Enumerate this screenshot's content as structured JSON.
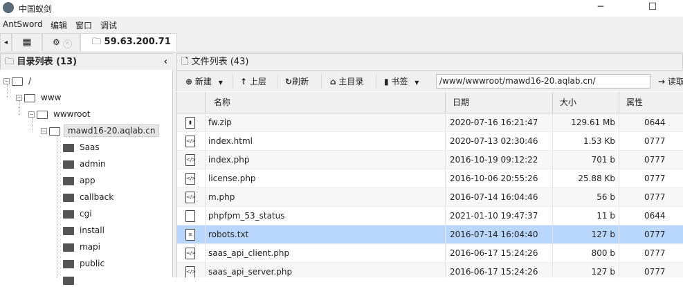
{
  "window": {
    "title": "中国蚁剑",
    "minimize": "─",
    "maximize": "☐",
    "close": "✕"
  },
  "menu": [
    "AntSword",
    "编辑",
    "窗口",
    "调试"
  ],
  "tabs": {
    "scroll_left": "◂",
    "grid_icon": "▦",
    "settings_icon": "⚙",
    "active": "59.63.200.71",
    "close": "×"
  },
  "left_panel": {
    "title": "目录列表 (13)",
    "collapse": "‹",
    "tree": [
      {
        "label": "/",
        "level": 0
      },
      {
        "label": "www",
        "level": 1
      },
      {
        "label": "wwwroot",
        "level": 2
      },
      {
        "label": "mawd16-20.aqlab.cn",
        "level": 3,
        "selected": true
      },
      {
        "label": "Saas",
        "level": 4
      },
      {
        "label": "admin",
        "level": 4
      },
      {
        "label": "app",
        "level": 4
      },
      {
        "label": "callback",
        "level": 4
      },
      {
        "label": "cgi",
        "level": 4
      },
      {
        "label": "install",
        "level": 4
      },
      {
        "label": "mapi",
        "level": 4
      },
      {
        "label": "public",
        "level": 4
      },
      {
        "label": "",
        "level": 4
      }
    ]
  },
  "right_panel": {
    "title": "文件列表 (43)",
    "toolbar": {
      "new": "新建",
      "up": "上层",
      "refresh": "刷新",
      "home": "主目录",
      "bookmark": "书签",
      "path": "/www/wwwroot/mawd16-20.aqlab.cn/",
      "read": "读取"
    },
    "columns": [
      "名称",
      "日期",
      "大小",
      "属性"
    ],
    "files": [
      {
        "name": "fw.zip",
        "date": "2020-07-16 16:21:47",
        "size": "129.61 Mb",
        "attr": "0644",
        "icon": "zip"
      },
      {
        "name": "index.html",
        "date": "2020-07-13 02:30:46",
        "size": "1.53 Kb",
        "attr": "0777",
        "icon": "code"
      },
      {
        "name": "index.php",
        "date": "2016-10-19 09:12:22",
        "size": "701 b",
        "attr": "0777",
        "icon": "code"
      },
      {
        "name": "license.php",
        "date": "2016-10-06 20:55:26",
        "size": "25.88 Kb",
        "attr": "0777",
        "icon": "code"
      },
      {
        "name": "m.php",
        "date": "2016-07-14 16:04:46",
        "size": "56 b",
        "attr": "0777",
        "icon": "code"
      },
      {
        "name": "phpfpm_53_status",
        "date": "2021-01-10 19:47:37",
        "size": "11 b",
        "attr": "0644",
        "icon": "file"
      },
      {
        "name": "robots.txt",
        "date": "2016-07-14 16:04:40",
        "size": "127 b",
        "attr": "0777",
        "icon": "text",
        "selected": true
      },
      {
        "name": "saas_api_client.php",
        "date": "2016-06-17 15:24:26",
        "size": "800 b",
        "attr": "0777",
        "icon": "code"
      },
      {
        "name": "saas_api_server.php",
        "date": "2016-06-17 15:24:26",
        "size": "127 b",
        "attr": "0777",
        "icon": "code"
      }
    ]
  },
  "colors": {
    "selection": "#b9d7fc",
    "chrome": "#f0f0f0"
  }
}
